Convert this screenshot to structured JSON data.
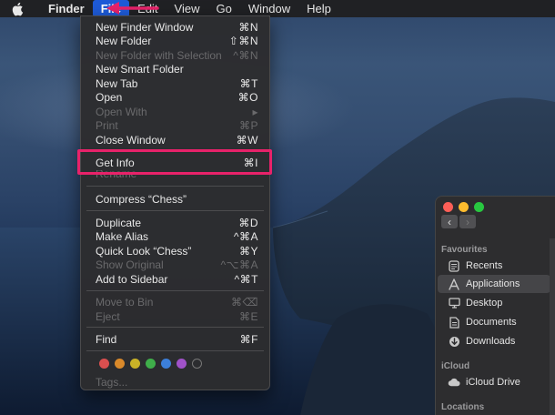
{
  "menubar": {
    "app_name": "Finder",
    "items": [
      "File",
      "Edit",
      "View",
      "Go",
      "Window",
      "Help"
    ]
  },
  "file_menu": {
    "items": [
      {
        "label": "New Finder Window",
        "shortcut": "⌘N",
        "disabled": false
      },
      {
        "label": "New Folder",
        "shortcut": "⇧⌘N",
        "disabled": false
      },
      {
        "label": "New Folder with Selection",
        "shortcut": "^⌘N",
        "disabled": true
      },
      {
        "label": "New Smart Folder",
        "shortcut": "",
        "disabled": false
      },
      {
        "label": "New Tab",
        "shortcut": "⌘T",
        "disabled": false
      },
      {
        "label": "Open",
        "shortcut": "⌘O",
        "disabled": false
      },
      {
        "label": "Open With",
        "shortcut": "▸",
        "disabled": true
      },
      {
        "label": "Print",
        "shortcut": "⌘P",
        "disabled": true
      },
      {
        "label": "Close Window",
        "shortcut": "⌘W",
        "disabled": false
      },
      {
        "label": "Get Info",
        "shortcut": "⌘I",
        "disabled": false
      },
      {
        "label": "Rename",
        "shortcut": "",
        "disabled": true
      },
      {
        "label": "Compress “Chess”",
        "shortcut": "",
        "disabled": false
      },
      {
        "label": "Duplicate",
        "shortcut": "⌘D",
        "disabled": false
      },
      {
        "label": "Make Alias",
        "shortcut": "^⌘A",
        "disabled": false
      },
      {
        "label": "Quick Look “Chess”",
        "shortcut": "⌘Y",
        "disabled": false
      },
      {
        "label": "Show Original",
        "shortcut": "^⌥⌘A",
        "disabled": true
      },
      {
        "label": "Add to Sidebar",
        "shortcut": "^⌘T",
        "disabled": false
      },
      {
        "label": "Move to Bin",
        "shortcut": "⌘⌫",
        "disabled": true
      },
      {
        "label": "Eject",
        "shortcut": "⌘E",
        "disabled": true
      },
      {
        "label": "Find",
        "shortcut": "⌘F",
        "disabled": false
      }
    ],
    "tags_label": "Tags...",
    "tag_colors": [
      "#d94f4f",
      "#d9892a",
      "#c9b227",
      "#3fae4a",
      "#3c7fd9",
      "#a052c8",
      "transparent"
    ]
  },
  "finder_sidebar": {
    "sections": [
      {
        "title": "Favourites",
        "items": [
          {
            "label": "Recents",
            "icon": "recents-icon"
          },
          {
            "label": "Applications",
            "icon": "applications-icon",
            "selected": true
          },
          {
            "label": "Desktop",
            "icon": "desktop-icon"
          },
          {
            "label": "Documents",
            "icon": "documents-icon"
          },
          {
            "label": "Downloads",
            "icon": "downloads-icon"
          }
        ]
      },
      {
        "title": "iCloud",
        "items": [
          {
            "label": "iCloud Drive",
            "icon": "cloud-icon"
          }
        ]
      },
      {
        "title": "Locations",
        "items": []
      }
    ]
  },
  "colors": {
    "menu_active": "#1e5bd8",
    "highlight_box": "#e8226a",
    "traffic_close": "#fe5f57",
    "traffic_min": "#febc2e",
    "traffic_max": "#28c840"
  }
}
